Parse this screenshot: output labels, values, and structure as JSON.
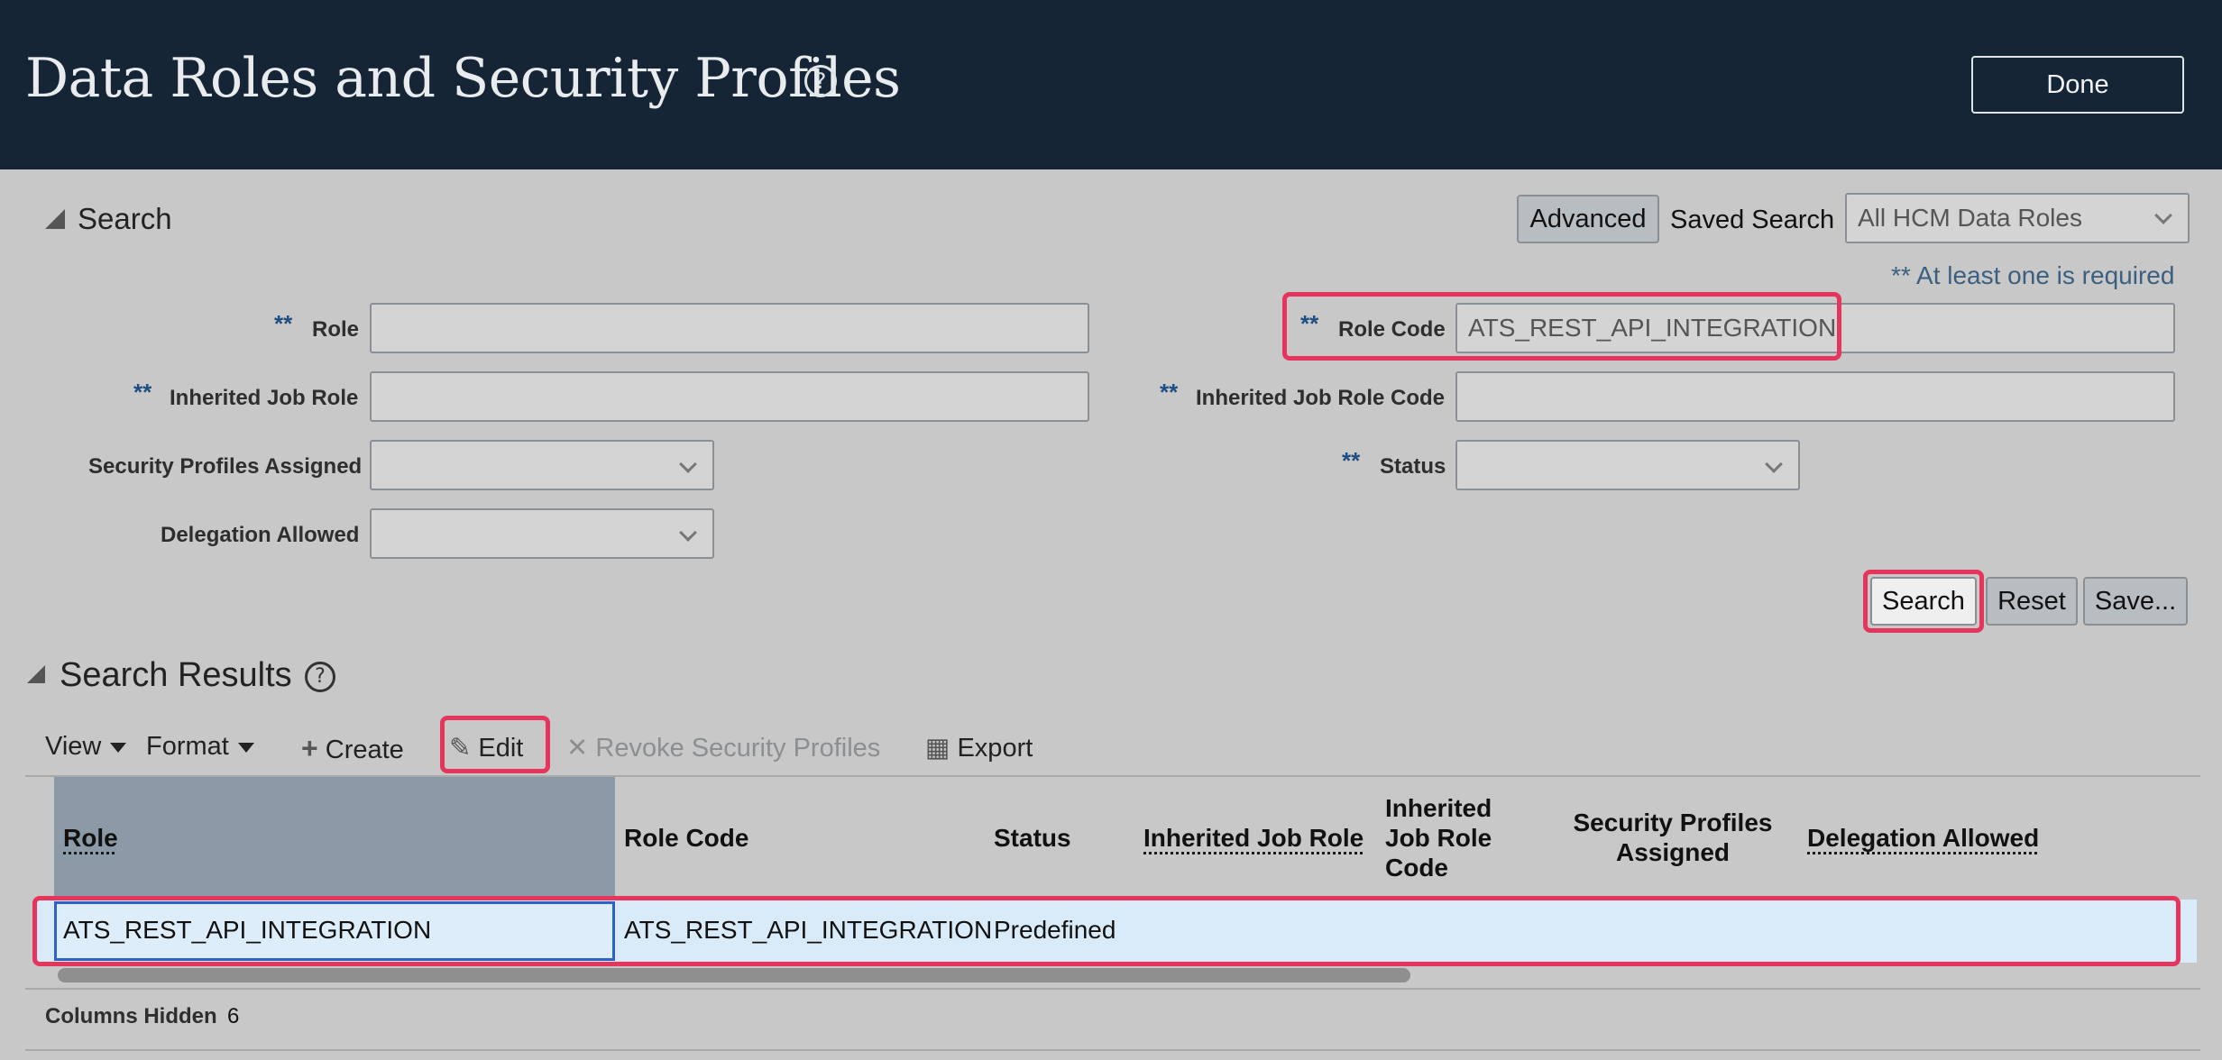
{
  "header": {
    "title": "Data Roles and Security Profiles",
    "help_glyph": "?",
    "done_label": "Done"
  },
  "search": {
    "section_title": "Search",
    "advanced_label": "Advanced",
    "saved_search_label": "Saved Search",
    "saved_search_value": "All HCM Data Roles",
    "required_note": "** At least one is required",
    "required_marker": "**",
    "fields": {
      "role_label": "Role",
      "role_value": "",
      "role_code_label": "Role Code",
      "role_code_value": "ATS_REST_API_INTEGRATION",
      "inherited_job_role_label": "Inherited Job Role",
      "inherited_job_role_value": "",
      "inherited_job_role_code_label": "Inherited Job Role Code",
      "inherited_job_role_code_value": "",
      "security_profiles_assigned_label": "Security Profiles Assigned",
      "security_profiles_assigned_value": "",
      "status_label": "Status",
      "status_value": "",
      "delegation_allowed_label": "Delegation Allowed",
      "delegation_allowed_value": ""
    },
    "search_button": "Search",
    "reset_button": "Reset",
    "save_button": "Save..."
  },
  "results": {
    "section_title": "Search Results",
    "help_glyph": "?",
    "toolbar": {
      "view": "View",
      "format": "Format",
      "create": "Create",
      "edit": "Edit",
      "revoke": "Revoke Security Profiles",
      "export": "Export"
    },
    "columns": {
      "role": "Role",
      "role_code": "Role Code",
      "status": "Status",
      "inherited_job_role": "Inherited Job Role",
      "inherited_job_role_code": "Inherited Job Role Code",
      "security_profiles_assigned": "Security Profiles Assigned",
      "delegation_allowed": "Delegation Allowed"
    },
    "rows": [
      {
        "role": "ATS_REST_API_INTEGRATION",
        "role_code": "ATS_REST_API_INTEGRATION",
        "status": "Predefined",
        "inherited_job_role": "",
        "inherited_job_role_code": "",
        "security_profiles_assigned": "",
        "delegation_allowed": ""
      }
    ],
    "columns_hidden_label": "Columns Hidden",
    "columns_hidden_count": "6"
  },
  "colors": {
    "header_bg": "#162535",
    "page_bg": "#c8c8c8",
    "highlight": "#e5355d",
    "selected_row": "#d9ebf9",
    "required_marker": "#1f4f82"
  }
}
